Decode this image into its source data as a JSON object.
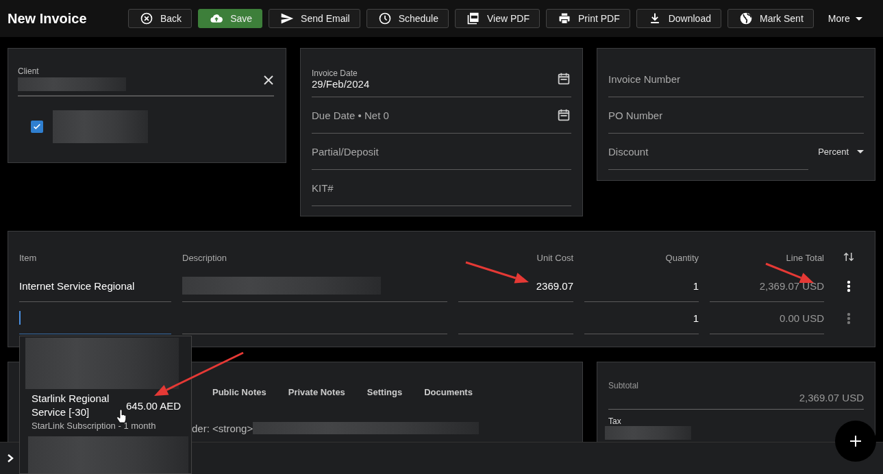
{
  "header": {
    "title": "New Invoice",
    "buttons": [
      {
        "label": "Back",
        "primary": false
      },
      {
        "label": "Save",
        "primary": true
      },
      {
        "label": "Send Email",
        "primary": false
      },
      {
        "label": "Schedule",
        "primary": false
      },
      {
        "label": "View PDF",
        "primary": false
      },
      {
        "label": "Print PDF",
        "primary": false
      },
      {
        "label": "Download",
        "primary": false
      },
      {
        "label": "Mark Sent",
        "primary": false
      }
    ],
    "more": "More"
  },
  "client": {
    "label": "Client",
    "contact_checked": true
  },
  "details": {
    "fields": [
      {
        "kind": "date",
        "label": "Invoice Date",
        "value": "29/Feb/2024"
      },
      {
        "kind": "date",
        "label": "Due Date • Net 0"
      },
      {
        "kind": "text",
        "label": "Partial/Deposit"
      },
      {
        "kind": "text",
        "label": "KIT#"
      }
    ]
  },
  "numbers": {
    "fields": [
      {
        "kind": "text",
        "label": "Invoice Number"
      },
      {
        "kind": "text",
        "label": "PO Number"
      },
      {
        "kind": "discount",
        "label": "Discount",
        "select": "Percent"
      }
    ]
  },
  "items": {
    "columns": [
      "Item",
      "Description",
      "Unit Cost",
      "Quantity",
      "Line Total"
    ],
    "rows": [
      {
        "item": "Internet Service Regional",
        "unit_cost": "2369.07",
        "quantity": "1",
        "line_total": "2,369.07 USD",
        "focused": false,
        "menu_active": true
      },
      {
        "quantity": "1",
        "line_total": "0.00 USD",
        "focused": true,
        "menu_active": false
      }
    ]
  },
  "notes": {
    "tabs": [
      {
        "label": "Public Notes",
        "selected": false
      },
      {
        "label": "Private Notes",
        "selected": false
      },
      {
        "label": "Settings",
        "selected": false
      },
      {
        "label": "Documents",
        "selected": false
      }
    ],
    "text": "der: <strong>"
  },
  "totals": {
    "subtotal_label": "Subtotal",
    "subtotal": "2,369.07 USD",
    "tax_label": "Tax"
  },
  "dropdown": {
    "items": [
      {
        "kind": "hidden"
      },
      {
        "kind": "product",
        "name": "Starlink Regional Service [-30]",
        "price": "645.00 AED",
        "description": "StarLink Subscription - 1 month"
      },
      {
        "kind": "hidden"
      }
    ]
  }
}
